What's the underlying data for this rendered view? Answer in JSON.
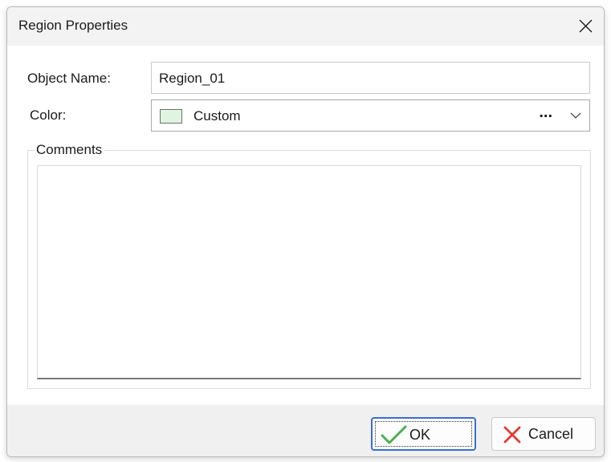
{
  "window": {
    "title": "Region Properties"
  },
  "form": {
    "object_name_label": "Object Name:",
    "object_name_value": "Region_01",
    "color_label": "Color:",
    "color_value": "Custom",
    "color_swatch": "#dff5e1",
    "color_more": "...",
    "comments_label": "Comments",
    "comments_value": ""
  },
  "buttons": {
    "ok_label": "OK",
    "cancel_label": "Cancel"
  },
  "icons": {
    "close": "close-icon",
    "chevron": "chevron-down-icon",
    "ok": "checkmark-icon",
    "cancel": "x-icon"
  },
  "colors": {
    "ok_check": "#4cae4f",
    "cancel_x": "#e53935",
    "default_button_border": "#3a6fd0"
  }
}
